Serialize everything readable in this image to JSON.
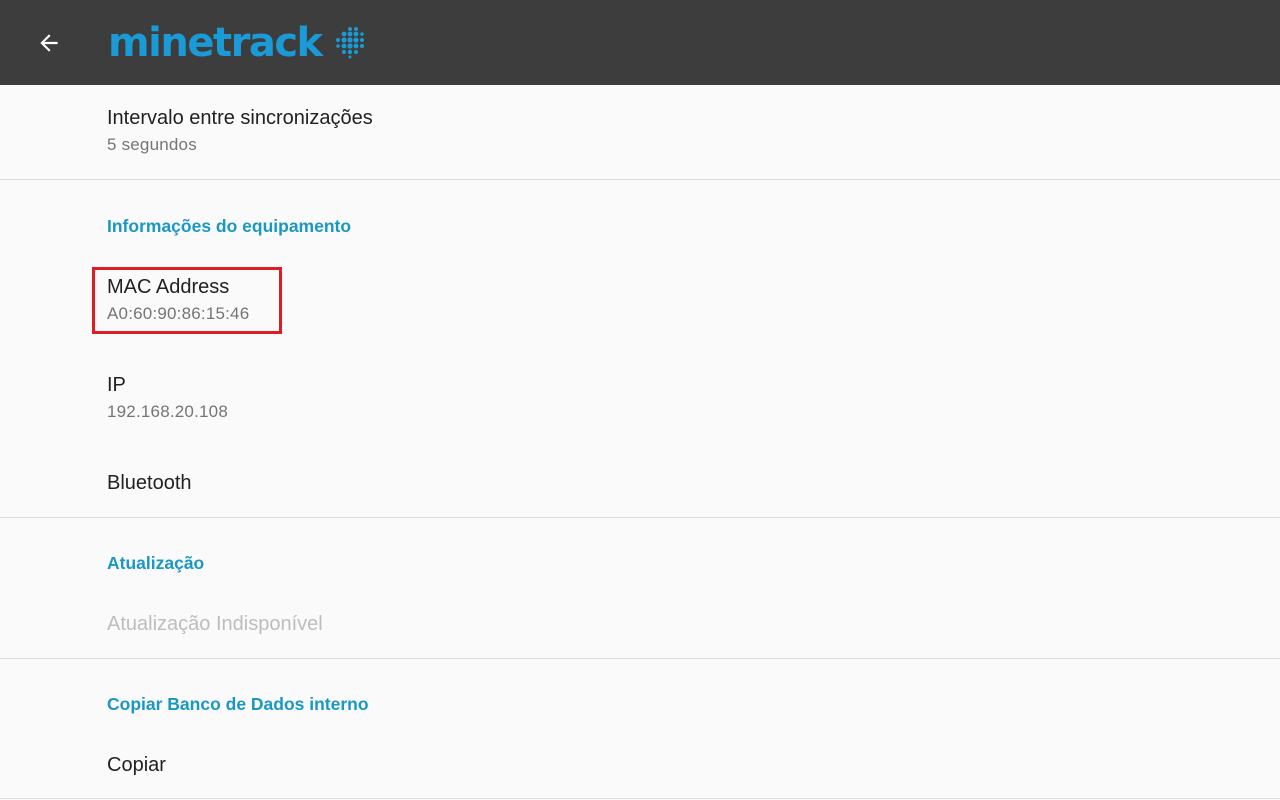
{
  "appbar": {
    "logo_text": "minetrack",
    "logo_color": "#1a9ad6",
    "back_icon": "arrow-left-icon",
    "background": "#3d3d3d"
  },
  "settings": {
    "sync_interval": {
      "title": "Intervalo entre sincronizações",
      "summary": "5 segundos"
    },
    "equipment_info": {
      "category": "Informações do equipamento",
      "mac": {
        "title": "MAC Address",
        "summary": "A0:60:90:86:15:46"
      },
      "ip": {
        "title": "IP",
        "summary": "192.168.20.108"
      },
      "bluetooth": {
        "title": "Bluetooth"
      }
    },
    "update": {
      "category": "Atualização",
      "status": "Atualização Indisponível"
    },
    "database": {
      "category": "Copiar Banco de Dados interno",
      "copy": "Copiar"
    }
  },
  "colors": {
    "category_accent": "#1a98c4",
    "highlight_box": "#e01b24"
  }
}
